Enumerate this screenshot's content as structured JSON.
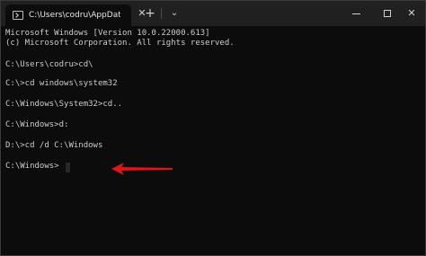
{
  "tab": {
    "title": "C:\\Users\\codru\\AppData\\Roa",
    "icon": "terminal-icon",
    "close_glyph": "✕"
  },
  "toolbar": {
    "new_tab_glyph": "+",
    "dropdown_glyph": "⌄"
  },
  "window_controls": {
    "minimize": "minimize-icon",
    "maximize": "maximize-icon",
    "close": "close-icon",
    "close_glyph": "✕"
  },
  "console": {
    "lines": [
      "Microsoft Windows [Version 10.0.22000.613]",
      "(c) Microsoft Corporation. All rights reserved.",
      "",
      "C:\\Users\\codru>cd\\",
      "",
      "C:\\>cd windows\\system32",
      "",
      "C:\\Windows\\System32>cd..",
      "",
      "C:\\Windows>d:",
      "",
      "D:\\>cd /d C:\\Windows",
      "",
      "C:\\Windows>"
    ]
  },
  "annotation": {
    "color": "#e0141b",
    "icon": "red-arrow-icon"
  }
}
